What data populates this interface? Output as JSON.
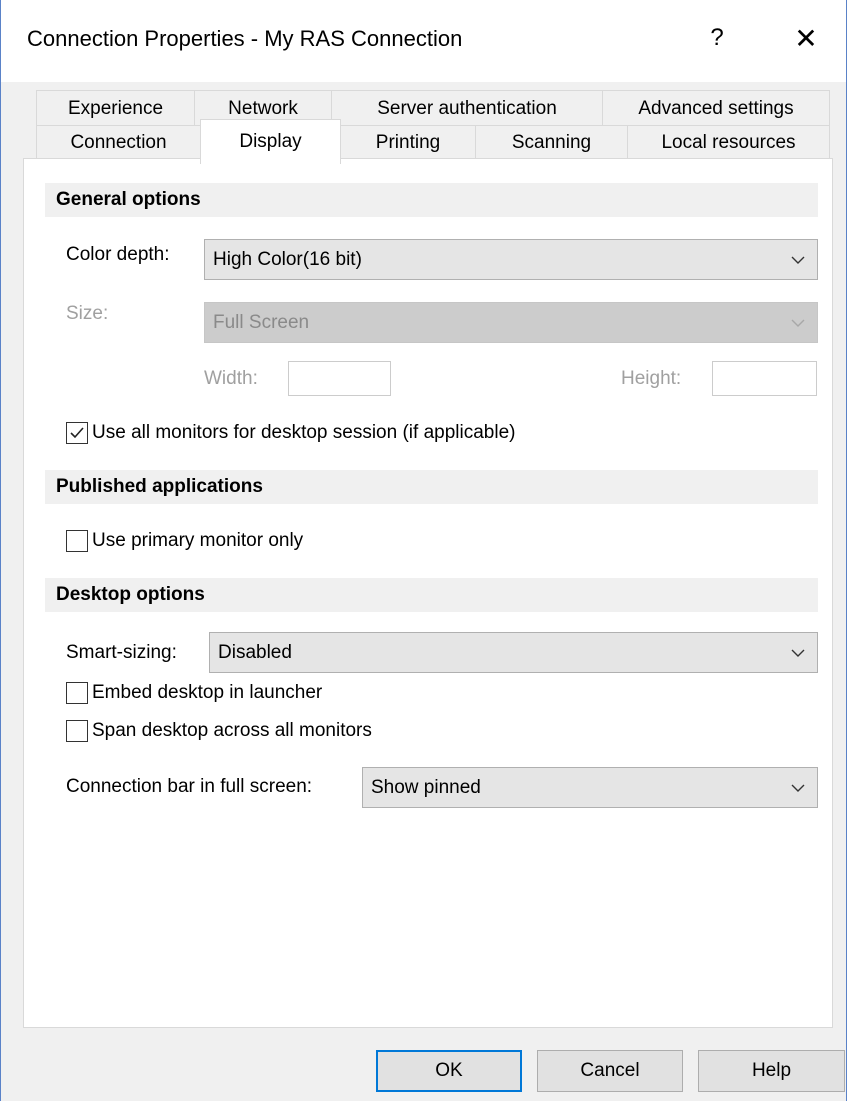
{
  "window": {
    "title": "Connection Properties - My RAS Connection",
    "help_glyph": "?",
    "close_glyph": "✕"
  },
  "tabs": {
    "row1": [
      "Experience",
      "Network",
      "Server authentication",
      "Advanced settings"
    ],
    "row2": [
      "Connection",
      "Display",
      "Printing",
      "Scanning",
      "Local resources"
    ],
    "active": "Display"
  },
  "general": {
    "header": "General options",
    "color_depth_label": "Color depth:",
    "color_depth_value": "High Color(16 bit)",
    "size_label": "Size:",
    "size_value": "Full Screen",
    "width_label": "Width:",
    "width_value": "",
    "height_label": "Height:",
    "height_value": "",
    "use_all_monitors_label": "Use all monitors for desktop session (if applicable)",
    "use_all_monitors_checked": true
  },
  "published": {
    "header": "Published applications",
    "primary_monitor_label": "Use primary monitor only",
    "primary_monitor_checked": false
  },
  "desktop": {
    "header": "Desktop options",
    "smart_sizing_label": "Smart-sizing:",
    "smart_sizing_value": "Disabled",
    "embed_label": "Embed desktop in launcher",
    "embed_checked": false,
    "span_label": "Span desktop across all monitors",
    "span_checked": false,
    "connection_bar_label": "Connection bar in full screen:",
    "connection_bar_value": "Show pinned"
  },
  "buttons": {
    "ok": "OK",
    "cancel": "Cancel",
    "help": "Help"
  },
  "colors": {
    "accent": "#0078d7",
    "window_border": "#5a82c8",
    "section_bg": "#f0f0f0"
  }
}
